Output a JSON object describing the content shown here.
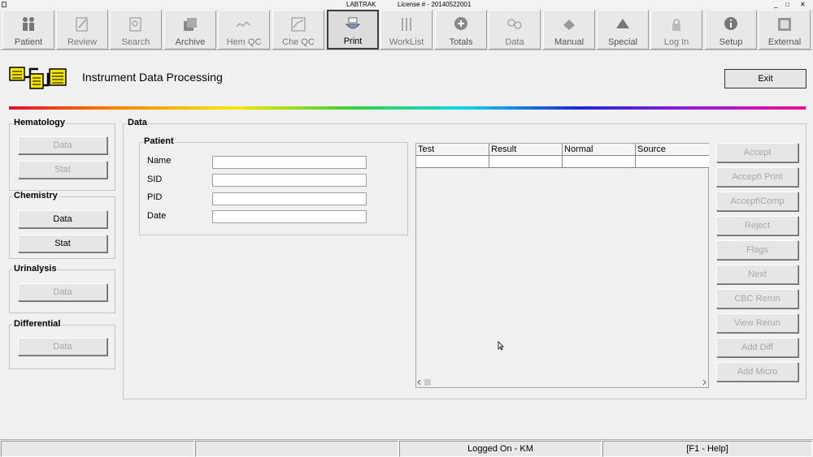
{
  "window": {
    "title": "LABTRAK",
    "license": "License # - 20140522001",
    "controls": [
      "_",
      "□",
      "✕"
    ]
  },
  "toolbar": [
    {
      "label": "Patient",
      "icon": "patient-icon",
      "enabled": true
    },
    {
      "label": "Review",
      "icon": "review-icon",
      "enabled": false
    },
    {
      "label": "Search",
      "icon": "search-icon",
      "enabled": false
    },
    {
      "label": "Archive",
      "icon": "archive-icon",
      "enabled": true
    },
    {
      "label": "Hem QC",
      "icon": "hem-qc-icon",
      "enabled": false
    },
    {
      "label": "Che QC",
      "icon": "che-qc-icon",
      "enabled": false
    },
    {
      "label": "Print",
      "icon": "print-icon",
      "enabled": true,
      "active": true
    },
    {
      "label": "WorkList",
      "icon": "worklist-icon",
      "enabled": false
    },
    {
      "label": "Totals",
      "icon": "totals-icon",
      "enabled": true
    },
    {
      "label": "Data",
      "icon": "data-icon",
      "enabled": false
    },
    {
      "label": "Manual",
      "icon": "manual-icon",
      "enabled": true
    },
    {
      "label": "Special",
      "icon": "special-icon",
      "enabled": true
    },
    {
      "label": "Log In",
      "icon": "lock-icon",
      "enabled": false
    },
    {
      "label": "Setup",
      "icon": "info-icon",
      "enabled": true
    },
    {
      "label": "External",
      "icon": "external-icon",
      "enabled": true
    }
  ],
  "header": {
    "title": "Instrument Data Processing",
    "exit_label": "Exit"
  },
  "sidebar": {
    "hematology": {
      "title": "Hematology",
      "data": "Data",
      "stat": "Stat"
    },
    "chemistry": {
      "title": "Chemistry",
      "data": "Data",
      "stat": "Stat"
    },
    "urinalysis": {
      "title": "Urinalysis",
      "data": "Data"
    },
    "differential": {
      "title": "Differential",
      "data": "Data"
    }
  },
  "data_group": {
    "title": "Data",
    "patient": {
      "title": "Patient",
      "fields": [
        {
          "label": "Name",
          "value": ""
        },
        {
          "label": "SID",
          "value": ""
        },
        {
          "label": "PID",
          "value": ""
        },
        {
          "label": "Date",
          "value": ""
        }
      ]
    }
  },
  "results": {
    "columns": [
      "Test",
      "Result",
      "Normal",
      "Source"
    ],
    "rows": [
      [
        "",
        "",
        "",
        ""
      ]
    ]
  },
  "actions": [
    "Accept",
    "Accept\\ Print",
    "Accept\\Comp",
    "Reject",
    "Flags",
    "Next",
    "CBC Rerun",
    "View Rerun",
    "Add Diff",
    "Add  Micro"
  ],
  "statusbar": [
    "",
    "",
    "Logged On - KM",
    "[F1 - Help]"
  ],
  "colors": {
    "background": "#f0f0f0",
    "active_border": "#3c3c3c"
  }
}
